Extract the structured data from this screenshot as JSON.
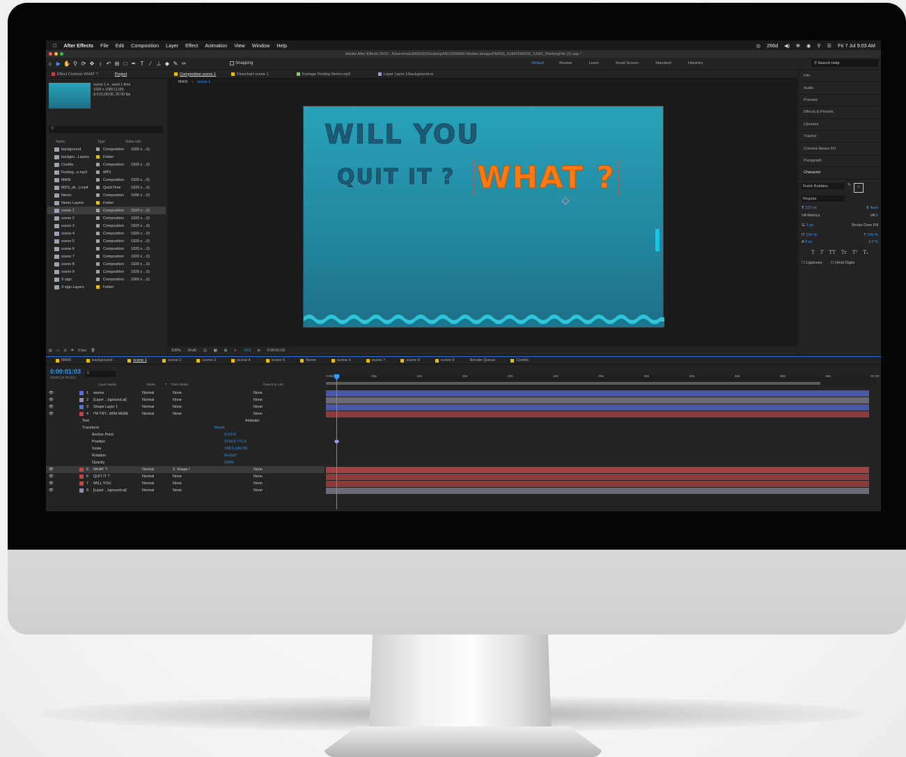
{
  "menubar": {
    "apple": "",
    "app": "After Effects",
    "items": [
      "File",
      "Edit",
      "Composition",
      "Layer",
      "Effect",
      "Animation",
      "View",
      "Window",
      "Help"
    ],
    "status": "266d",
    "date": "Fri 7 Jul 9:03 AM"
  },
  "titlebar": {
    "title": "Adobe After Effects 2023 - /Users/mds3000325/Desktop/MDS/DM300-Motion design/DM300_S1M2/DM300_S1M2_WorkingFile (2).aep *"
  },
  "toolbar": {
    "snapping": "Snapping",
    "workspaces": [
      "Default",
      "Review",
      "Learn",
      "Small Screen",
      "Standard",
      "Libraries"
    ],
    "search": "Search Help"
  },
  "left_tabs": {
    "effect_controls": "Effect Controls WHAT ?",
    "project": "Project"
  },
  "project": {
    "thumb_title": "scene 1 ▾ , used 1 time",
    "thumb_size": "1920 x 1080 (1.00)",
    "thumb_dur": "Δ 0;01;00;00, 25.00 fps",
    "cols": {
      "name": "Name",
      "type": "Type",
      "video": "Video Info"
    },
    "items": [
      {
        "name": "background",
        "type": "Composition",
        "video": "1000 x ...0)",
        "tag": "#a3a3a3"
      },
      {
        "name": "backgro...Layers",
        "type": "Folder",
        "video": "",
        "tag": "#e8c200"
      },
      {
        "name": "Credits",
        "type": "Composition",
        "video": "1920 x ...0)",
        "tag": "#a3a3a3"
      },
      {
        "name": "Finding...o.mp3",
        "type": "MP3",
        "video": "",
        "tag": "#a3a3a3"
      },
      {
        "name": "MAIN",
        "type": "Composition",
        "video": "1920 x ...0)",
        "tag": "#a3a3a3"
      },
      {
        "name": "MDS_sti...).mp4",
        "type": "QuickTime",
        "video": "1920 x ...0)",
        "tag": "#a3a3a3"
      },
      {
        "name": "Nemo",
        "type": "Composition",
        "video": "1000 x ...0)",
        "tag": "#a3a3a3"
      },
      {
        "name": "Nemo Layers",
        "type": "Folder",
        "video": "",
        "tag": "#e8c200"
      },
      {
        "name": "scene 1",
        "type": "Composition",
        "video": "1920 x ...0)",
        "tag": "#a3a3a3"
      },
      {
        "name": "scene 2",
        "type": "Composition",
        "video": "1920 x ...0)",
        "tag": "#a3a3a3"
      },
      {
        "name": "scene 3",
        "type": "Composition",
        "video": "1920 x ...0)",
        "tag": "#a3a3a3"
      },
      {
        "name": "scene 4",
        "type": "Composition",
        "video": "1920 x ...0)",
        "tag": "#a3a3a3"
      },
      {
        "name": "scene 5",
        "type": "Composition",
        "video": "1920 x ...0)",
        "tag": "#a3a3a3"
      },
      {
        "name": "scene 6",
        "type": "Composition",
        "video": "1920 x ...0)",
        "tag": "#a3a3a3"
      },
      {
        "name": "scene 7",
        "type": "Composition",
        "video": "1920 x ...0)",
        "tag": "#a3a3a3"
      },
      {
        "name": "scene 8",
        "type": "Composition",
        "video": "1920 x ...0)",
        "tag": "#a3a3a3"
      },
      {
        "name": "scene 9",
        "type": "Composition",
        "video": "1920 x ...0)",
        "tag": "#a3a3a3"
      },
      {
        "name": "X sign",
        "type": "Composition",
        "video": "1000 x ...0)",
        "tag": "#a3a3a3"
      },
      {
        "name": "X sign Layers",
        "type": "Folder",
        "video": "",
        "tag": "#e8c200"
      }
    ],
    "bpc": "8 bpc"
  },
  "comp_tabs": [
    "Composition scene 1",
    "Flowchart scene 1",
    "Footage Finding Nemo.mp3",
    "Layer Layer 1/background.ai"
  ],
  "breadcrumb": {
    "main": "MAIN",
    "scene": "scene 1"
  },
  "comp": {
    "line1": "WILL YOU",
    "line2": "QUIT IT ?",
    "what": "WHAT ?"
  },
  "viewer_bar": {
    "zoom": "100%",
    "res": "(Full)",
    "exposure": "+0.0",
    "time": "0:00:01:03"
  },
  "right_panels": [
    "Info",
    "Audio",
    "Preview",
    "Effects & Presets",
    "Libraries",
    "Tracker",
    "Content-Aware Fill",
    "Paragraph",
    "Character"
  ],
  "character": {
    "font": "Rubik Bubbles",
    "style": "Regular",
    "size": "153 px",
    "leading": "Auto",
    "kerning": "Metrics",
    "tracking": "0",
    "stroke": "1 px",
    "stroke_mode": "Stroke Over Fill",
    "vscale": "100 %",
    "hscale": "100 %",
    "baseline": "0 px",
    "tsume": "0 %",
    "ligatures": "Ligatures",
    "hindi": "Hindi Digits"
  },
  "timeline": {
    "tabs": [
      "MAIN",
      "background",
      "scene 1",
      "scene 2",
      "scene 3",
      "scene 4",
      "scene 5",
      "Nemo",
      "scene 6",
      "scene 7",
      "scene 8",
      "scene 9",
      "Render Queue",
      "Credits"
    ],
    "timecode": "0:00:01:03",
    "fps": "00028 (25.00 fps)",
    "cols": {
      "layer": "Layer Name",
      "mode": "Mode",
      "t": "T",
      "matte": "Track Matte",
      "parent": "Parent & Link"
    },
    "ruler": [
      "0:00s",
      "05s",
      "10s",
      "15s",
      "20s",
      "25s",
      "30s",
      "35s",
      "40s",
      "45s",
      "50s",
      "55s",
      "01:00"
    ],
    "layers": [
      {
        "num": "1",
        "name": "waves",
        "mode": "Normal",
        "matte": "None",
        "parent": "None",
        "color": "#5a6fd1",
        "bar": "#4a56a8"
      },
      {
        "num": "2",
        "name": "[Layer ...kground.ai]",
        "mode": "Normal",
        "matte": "None",
        "parent": "None",
        "color": "#8e8ea8",
        "bar": "#6a6a78"
      },
      {
        "num": "3",
        "name": "Shape Layer 1",
        "mode": "Normal",
        "matte": "None",
        "parent": "None",
        "color": "#5a6fd1",
        "bar": "#4a56a8"
      },
      {
        "num": "4",
        "name": "I'M TRY...WIM HERE",
        "mode": "Normal",
        "matte": "None",
        "parent": "None",
        "color": "#c04545",
        "bar": "#8c3a3a"
      }
    ],
    "props": {
      "text": "Text",
      "animate": "Animate:",
      "transform": "Transform",
      "reset": "Reset",
      "anchor": "Anchor Point",
      "anchor_v": "0.0,0.0",
      "position": "Position",
      "position_v": "2714.5,771.0",
      "scale": "Scale",
      "scale_v": "100.0,100.0%",
      "rotation": "Rotation",
      "rotation_v": "0x+0.0°",
      "opacity": "Opacity",
      "opacity_v": "100%"
    },
    "layers2": [
      {
        "num": "5",
        "name": "WHAT ?",
        "mode": "Normal",
        "matte": "3. Shape I",
        "parent": "None",
        "color": "#c04545",
        "bar": "#a14141"
      },
      {
        "num": "6",
        "name": "QUIT IT ?",
        "mode": "Normal",
        "matte": "None",
        "parent": "None",
        "color": "#c04545",
        "bar": "#8c3a3a"
      },
      {
        "num": "7",
        "name": "WILL YOU",
        "mode": "Normal",
        "matte": "None",
        "parent": "None",
        "color": "#c04545",
        "bar": "#8c3a3a"
      },
      {
        "num": "8",
        "name": "[Layer ...kground.ai]",
        "mode": "Normal",
        "matte": "None",
        "parent": "None",
        "color": "#8e8ea8",
        "bar": "#6a6a78"
      }
    ]
  },
  "colors": {
    "accent": "#2f9bff",
    "comp_top": "#27a2b8",
    "comp_bottom": "#1e6f88",
    "text_dark": "#1c5a75",
    "text_orange": "#ff7a12"
  }
}
